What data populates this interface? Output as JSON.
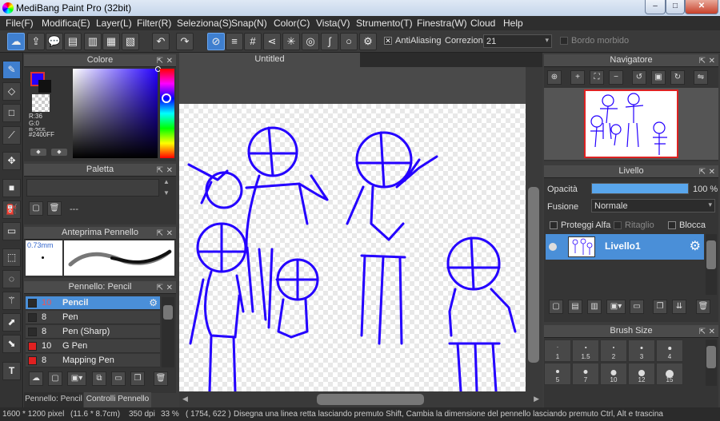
{
  "window": {
    "title": "MediBang Paint Pro (32bit)",
    "min": "–",
    "max": "□",
    "close": "✕"
  },
  "menu": [
    "File(F)",
    "Modifica(E)",
    "Layer(L)",
    "Filter(R)",
    "Seleziona(S)",
    "Snap(N)",
    "Color(C)",
    "Vista(V)",
    "Strumento(T)",
    "Finestra(W)",
    "Cloud",
    "Help"
  ],
  "toolbar": {
    "antialias_label": "AntiAliasing",
    "correction_label": "Correzione",
    "correction_value": "21",
    "soft_edge_label": "Bordo morbido"
  },
  "color_panel": {
    "title": "Colore",
    "r": "R:36",
    "g": "G:0",
    "b": "B:255",
    "hex": "#2400FF",
    "primary_color": "#2400ff"
  },
  "palette_panel": {
    "title": "Paletta",
    "value": "---"
  },
  "brush_preview": {
    "title": "Anteprima Pennello",
    "size": "0.73mm"
  },
  "brush_panel": {
    "title": "Pennello: Pencil",
    "items": [
      {
        "size": "10",
        "name": "Pencil",
        "color": "#2b2b2b"
      },
      {
        "size": "8",
        "name": "Pen",
        "color": "#2b2b2b"
      },
      {
        "size": "8",
        "name": "Pen (Sharp)",
        "color": "#2b2b2b"
      },
      {
        "size": "10",
        "name": "G Pen",
        "color": "#e02020"
      },
      {
        "size": "8",
        "name": "Mapping Pen",
        "color": "#e02020"
      }
    ]
  },
  "bottom_tabs": {
    "tab1": "Pennello: Pencil",
    "tab2": "Controlli Pennello"
  },
  "document": {
    "tab": "Untitled"
  },
  "navigator": {
    "title": "Navigatore"
  },
  "layer_panel": {
    "title": "Livello",
    "opacity_label": "Opacità",
    "opacity_value": "100 %",
    "opacity": 1.0,
    "blend_label": "Fusione",
    "blend_value": "Normale",
    "protect_alpha": "Proteggi Alfa",
    "clipping": "Ritaglio",
    "lock": "Blocca",
    "layer_name": "Livello1"
  },
  "brush_size": {
    "title": "Brush Size",
    "sizes": [
      "1",
      "1.5",
      "2",
      "3",
      "4",
      "5",
      "7",
      "10",
      "12",
      "15"
    ]
  },
  "status": {
    "dims": "1600 * 1200 pixel",
    "cm": "(11.6 * 8.7cm)",
    "dpi": "350 dpi",
    "zoom": "33 %",
    "coords": "( 1754, 622 )",
    "hint": "Disegna una linea retta lasciando premuto Shift, Cambia la dimensione del pennello lasciando premuto Ctrl, Alt e trascina"
  }
}
